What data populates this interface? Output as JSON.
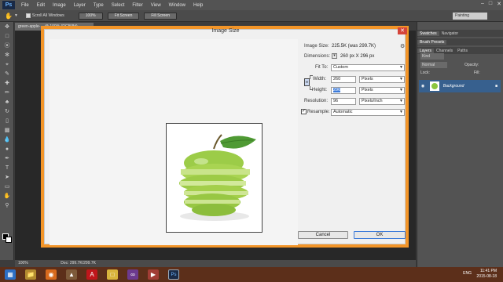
{
  "menubar": {
    "logo": "Ps",
    "items": [
      "File",
      "Edit",
      "Image",
      "Layer",
      "Type",
      "Select",
      "Filter",
      "View",
      "Window",
      "Help"
    ]
  },
  "options": {
    "scroll_all_windows": "Scroll All Windows",
    "btn_100": "100%",
    "btn_fit_screen": "Fit Screen",
    "btn_fill_screen": "Fill Screen",
    "workspace": "Painting"
  },
  "document": {
    "tab_title": "green-apple-... @ 100% (RGB/8#)",
    "zoom": "100%",
    "doc_size": "Doc: 299.7K/299.7K"
  },
  "dialog": {
    "title": "Image Size",
    "image_size_label": "Image Size:",
    "image_size_value": "225.5K (was 299.7K)",
    "dimensions_label": "Dimensions:",
    "dimensions_value": "260 px  X  296 px",
    "fit_to_label": "Fit To:",
    "fit_to_value": "Custom",
    "width_label": "Width:",
    "width_value": "260",
    "width_unit": "Pixels",
    "height_label": "Height:",
    "height_value": "296",
    "height_unit": "Pixels",
    "resolution_label": "Resolution:",
    "resolution_value": "96",
    "resolution_unit": "Pixels/Inch",
    "resample_label": "Resample:",
    "resample_value": "Automatic",
    "cancel": "Cancel",
    "ok": "OK"
  },
  "panels": {
    "tabs_top": [
      "Swatches",
      "Navigator"
    ],
    "tabs_mid": [
      "Brush Presets"
    ],
    "tabs_layers": [
      "Layers",
      "Channels",
      "Paths"
    ],
    "kind": "Kind",
    "blend": "Normal",
    "opacity_label": "Opacity:",
    "lock_label": "Lock:",
    "fill_label": "Fill:",
    "layer_name": "Background"
  },
  "taskbar": {
    "lang": "ENG",
    "time": "11:41 PM",
    "date": "2015-08-18"
  }
}
